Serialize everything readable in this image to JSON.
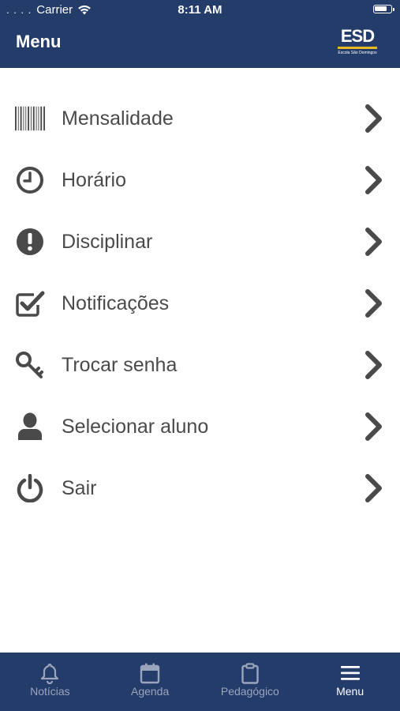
{
  "status_bar": {
    "dots": ". . . .",
    "carrier": "Carrier",
    "time": "8:11 AM"
  },
  "nav": {
    "title": "Menu",
    "logo_text": "ESD",
    "logo_subtitle": "Escola São Domingos"
  },
  "menu": {
    "items": [
      {
        "label": "Mensalidade",
        "icon": "barcode-icon"
      },
      {
        "label": "Horário",
        "icon": "clock-icon"
      },
      {
        "label": "Disciplinar",
        "icon": "exclamation-circle-icon"
      },
      {
        "label": "Notificações",
        "icon": "checkbox-checked-icon"
      },
      {
        "label": "Trocar senha",
        "icon": "key-icon"
      },
      {
        "label": "Selecionar aluno",
        "icon": "user-icon"
      },
      {
        "label": "Sair",
        "icon": "power-icon"
      }
    ]
  },
  "tabbar": {
    "tabs": [
      {
        "label": "Notícias",
        "icon": "bell-icon",
        "active": false
      },
      {
        "label": "Agenda",
        "icon": "calendar-icon",
        "active": false
      },
      {
        "label": "Pedagógico",
        "icon": "clipboard-icon",
        "active": false
      },
      {
        "label": "Menu",
        "icon": "hamburger-icon",
        "active": true
      }
    ]
  },
  "colors": {
    "primary": "#243c6a",
    "accent": "#e8b923",
    "text": "#4a4a4a",
    "tab_inactive": "#9aa5bd",
    "tab_active": "#ffffff"
  }
}
